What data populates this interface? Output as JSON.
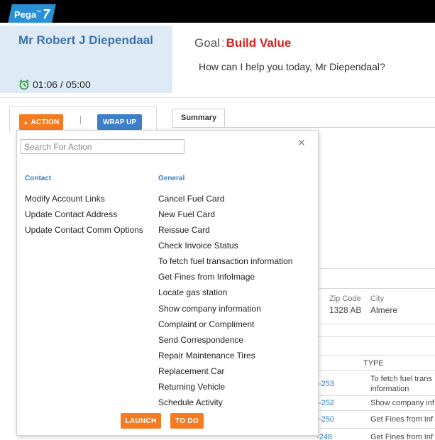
{
  "header": {
    "logo_text": "Pega",
    "logo_version": "7"
  },
  "contact": {
    "name": "Mr Robert J Diependaal",
    "timer": "01:06 / 05:00"
  },
  "goal": {
    "label": "Goal",
    "value": "Build Value"
  },
  "greeting": "How can I help you today, Mr Diependaal?",
  "toolbar": {
    "action_label": "ACTION",
    "wrap_up_label": "WRAP UP"
  },
  "tabs": [
    {
      "label": "Summary"
    }
  ],
  "background": {
    "zip_label": "Zip Code",
    "zip_value": "1328 AB",
    "city_label": "City",
    "city_value": "Almere",
    "type_header": "TYPE",
    "rows": [
      {
        "id": "-253",
        "type": "To fetch fuel trans",
        "type_line2": "information"
      },
      {
        "id": "-252",
        "type": "Show company inf"
      },
      {
        "id": "-250",
        "type": "Get Fines from Inf"
      },
      {
        "id": "-248",
        "type": "Get Fines from Inf"
      }
    ]
  },
  "menu": {
    "search_placeholder": "Search For Action",
    "contact_heading": "Contact",
    "general_heading": "General",
    "contact_items": [
      "Modify Account Links",
      "Update Contact Address",
      "Update Contact Comm Options"
    ],
    "general_items": [
      "Cancel Fuel Card",
      "New Fuel Card",
      "Reissue Card",
      "Check Invoice Status",
      "To fetch fuel transaction information",
      "Get Fines from InfoImage",
      "Locate gas station",
      "Show company information",
      "Complaint or Compliment",
      "Send Correspondence",
      "Repair Maintenance Tires",
      "Replacement Car",
      "Returning Vehicle",
      "Schedule Activity"
    ],
    "launch_label": "LAUNCH",
    "todo_label": "TO DO"
  },
  "colors": {
    "accent_orange": "#f47b20",
    "accent_blue": "#3d7fc8",
    "goal_red": "#d6201f",
    "card_bg": "#deebf6"
  }
}
